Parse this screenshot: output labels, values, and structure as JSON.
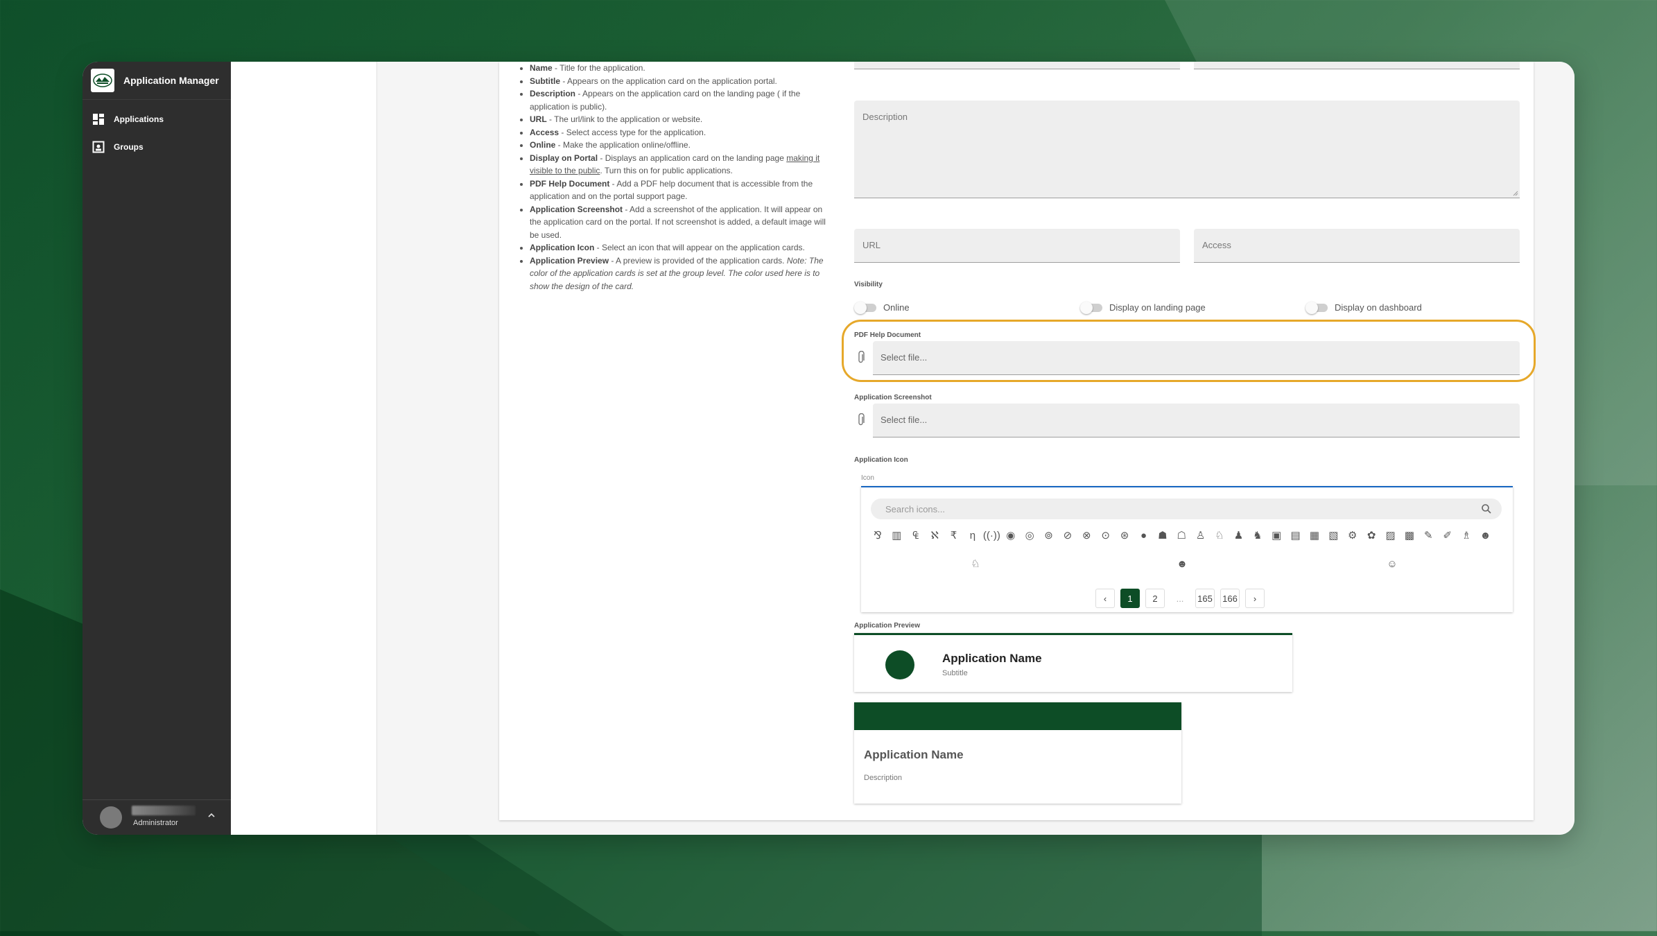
{
  "app": {
    "title": "Application Manager"
  },
  "sidebar": {
    "items": [
      {
        "label": "Applications",
        "icon": "dashboard-icon"
      },
      {
        "label": "Groups",
        "icon": "groups-icon"
      }
    ]
  },
  "user": {
    "role": "Administrator"
  },
  "help": {
    "items": [
      {
        "term": "Name",
        "text": " - Title for the application."
      },
      {
        "term": "Subtitle",
        "text": " - Appears on the application card on the application portal."
      },
      {
        "term": "Description",
        "text": " - Appears on the application card on the landing page ( if the application is public)."
      },
      {
        "term": "URL",
        "text": " - The url/link to the application or website."
      },
      {
        "term": "Access",
        "text": " - Select access type for the application."
      },
      {
        "term": "Online",
        "text": " - Make the application online/offline."
      },
      {
        "term": "Display on Portal",
        "text": " - Displays an application card on the landing page ",
        "link": "making it visible to the public",
        "after": ". Turn this on for public applications."
      },
      {
        "term": "PDF Help Document",
        "text": " - Add a PDF help document that is accessible from the application and on the portal support page."
      },
      {
        "term": "Application Screenshot",
        "text": " - Add a screenshot of the application. It will appear on the application card on the portal. If not screenshot is added, a default image will be used."
      },
      {
        "term": "Application Icon",
        "text": " - Select an icon that will appear on the application cards."
      },
      {
        "term": "Application Preview",
        "text": " - A preview is provided of the application cards. ",
        "note": "Note: The color of the application cards is set at the group level. The color used here is to show the design of the card."
      }
    ]
  },
  "form": {
    "description_label": "Description",
    "url_label": "URL",
    "access_label": "Access",
    "visibility_label": "Visibility",
    "toggles": {
      "online": "Online",
      "landing": "Display on landing page",
      "dashboard": "Display on dashboard"
    },
    "pdf_label": "PDF Help Document",
    "pdf_placeholder": "Select file...",
    "screenshot_label": "Application Screenshot",
    "screenshot_placeholder": "Select file...",
    "icon_section_label": "Application Icon",
    "icon_field_label": "Icon",
    "icon_search_placeholder": "Search icons...",
    "pagination": {
      "pages": [
        "1",
        "2",
        "...",
        "165",
        "166"
      ],
      "current": "1"
    },
    "preview_label": "Application Preview"
  },
  "preview": {
    "horizontal": {
      "name": "Application Name",
      "subtitle": "Subtitle"
    },
    "vertical": {
      "name": "Application Name",
      "description": "Description"
    }
  },
  "colors": {
    "brand": "#0d4d26",
    "highlight": "#e6a82a",
    "sidebar": "#2e2e2e"
  }
}
